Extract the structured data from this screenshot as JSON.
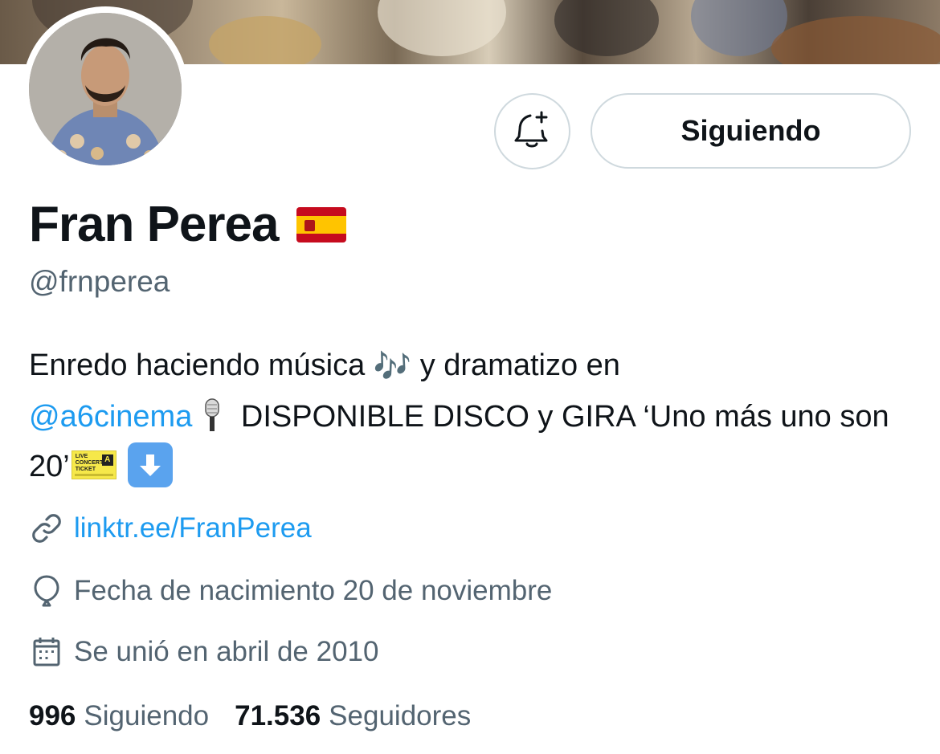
{
  "profile": {
    "display_name": "Fran Perea",
    "handle": "@frnperea",
    "follow_button_label": "Siguiendo",
    "bio": {
      "part1": "Enredo haciendo música ",
      "part2": " y dramatizo en ",
      "mention": "@a6cinema",
      "part3": " DISPONIBLE DISCO y GIRA ‘Uno más uno son 20’",
      "music_emoji": "🎶",
      "ticket_emoji": {
        "line1": "LIVE",
        "line2": "CONCERT",
        "line3": "TICKET",
        "zone": "A"
      }
    },
    "website": "linktr.ee/FranPerea",
    "birthday": "Fecha de nacimiento 20 de noviembre",
    "joined": "Se unió en abril de 2010",
    "following_count": "996",
    "following_label": "Siguiendo",
    "followers_count": "71.536",
    "followers_label": "Seguidores"
  },
  "icons": {
    "notification": "bell-plus-icon",
    "link": "link-icon",
    "birthday": "balloon-icon",
    "calendar": "calendar-icon",
    "flag": "spain-flag-icon",
    "mic": "microphone-icon",
    "ticket": "ticket-icon",
    "down": "down-arrow-icon"
  },
  "colors": {
    "accent": "#1d9bf0",
    "text": "#0f1419",
    "secondary": "#536471",
    "border": "#cfd9de"
  }
}
